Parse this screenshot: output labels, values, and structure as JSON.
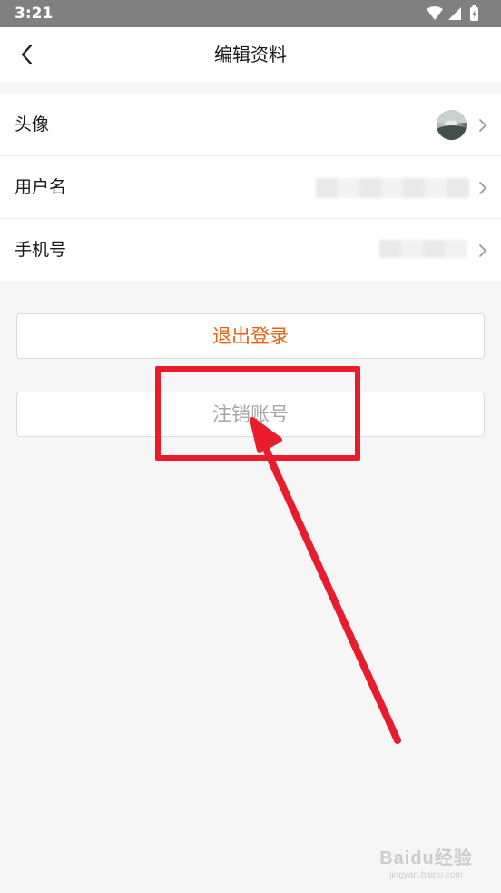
{
  "status_bar": {
    "time": "3:21",
    "icons": [
      "wifi-icon",
      "cell-signal-icon",
      "battery-icon"
    ]
  },
  "nav": {
    "back_icon": "chevron-left-icon",
    "title": "编辑资料"
  },
  "rows": [
    {
      "label": "头像",
      "value_type": "avatar-image"
    },
    {
      "label": "用户名",
      "value_type": "blurred-text"
    },
    {
      "label": "手机号",
      "value_type": "blurred-text"
    }
  ],
  "buttons": {
    "logout": "退出登录",
    "cancel_account": "注销账号"
  },
  "colors": {
    "accent": "#e8600c",
    "annotation": "#e81c2a",
    "disabled_text": "#a6a6a6",
    "page_bg": "#f6f6f6"
  },
  "watermark": {
    "logo": "Baidu经验",
    "sub": "jingyan.baidu.com"
  }
}
